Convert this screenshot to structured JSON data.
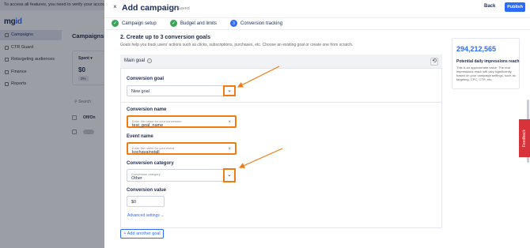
{
  "banner": {
    "text": "To access all features, you need to verify your account and"
  },
  "logo": {
    "text_a": "mg",
    "text_b": "id"
  },
  "sidebar": {
    "items": [
      {
        "label": "Campaigns",
        "icon": "megaphone-icon",
        "active": true
      },
      {
        "label": "CTR Guard",
        "icon": "shield-icon"
      },
      {
        "label": "Retargeting audiences",
        "icon": "target-icon"
      },
      {
        "label": "Finance",
        "icon": "wallet-icon"
      },
      {
        "label": "Reports",
        "icon": "report-icon"
      }
    ]
  },
  "background": {
    "title": "Campaigns",
    "spent_label": "Spent ▾",
    "spent_value": "$0",
    "spent_pct": "0%",
    "search_label": "Search",
    "onoff_label": "Off/On"
  },
  "panel": {
    "title": "Add campaign",
    "saved": "Saved",
    "back_label": "Back",
    "publish_label": "Publish",
    "close_glyph": "×"
  },
  "steps": [
    {
      "label": "Campaign setup",
      "state": "done"
    },
    {
      "label": "Budget and limits",
      "state": "done"
    },
    {
      "label": "Conversion tracking",
      "state": "current",
      "number": "3"
    }
  ],
  "goals": {
    "section_title": "2. Create up to 3 conversion goals",
    "section_desc": "Goals help you track users' actions such as clicks, subscriptions, purchases, etc. Choose an existing goal or create one from scratch.",
    "main_goal_label": "Main goal",
    "conversion_goal_label": "Conversion goal",
    "conversion_goal_value": "New goal",
    "conversion_name_label": "Conversion name",
    "conversion_name_placeholder": "Enter the name for your conversion",
    "conversion_name_value": "test_goal_name",
    "event_name_label": "Event name",
    "event_name_placeholder": "Enter the name for your event",
    "event_name_value": "kochavainstall",
    "category_label": "Conversion category",
    "category_placeholder": "Conversion category",
    "category_value": "Other",
    "value_label": "Conversion value",
    "value_value": "$0",
    "advanced_label": "Advanced settings ⌄",
    "add_goal_label": "+ Add another goal"
  },
  "impressions": {
    "value": "294,212,565",
    "title": "Potential daily impressions reach",
    "desc": "This is an approximate value. The real impressions reach will vary significantly based on your campaign settings, such as targeting, CPC, CTR, etc."
  },
  "feedback": {
    "label": "Feedback"
  },
  "colors": {
    "accent": "#2d6bff",
    "highlight": "#f07b12",
    "done": "#3aa457",
    "feedback": "#d8333a"
  }
}
